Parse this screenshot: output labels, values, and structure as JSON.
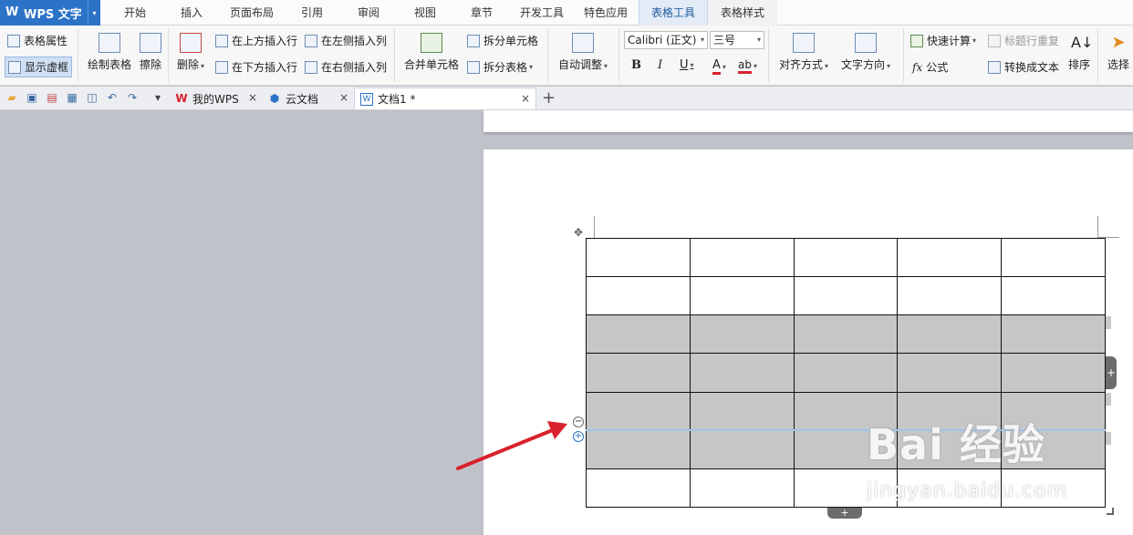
{
  "app": {
    "title": "WPS 文字",
    "logo": "W",
    "menu_arrow": "▾"
  },
  "menu_tabs": [
    "开始",
    "插入",
    "页面布局",
    "引用",
    "审阅",
    "视图",
    "章节",
    "开发工具",
    "特色应用",
    "表格工具",
    "表格样式"
  ],
  "ribbon": {
    "table_props": "表格属性",
    "show_gridlines": "显示虚框",
    "draw_table": "绘制表格",
    "erase": "擦除",
    "delete": "删除",
    "insert_row_above": "在上方插入行",
    "insert_row_below": "在下方插入行",
    "insert_col_left": "在左侧插入列",
    "insert_col_right": "在右侧插入列",
    "merge_cells": "合并单元格",
    "split_cells": "拆分单元格",
    "split_table": "拆分表格",
    "auto_fit": "自动调整",
    "font_name": "Calibri (正文)",
    "font_size": "三号",
    "bold": "B",
    "italic": "I",
    "underline": "U",
    "font_color": "A",
    "highlight": "ab",
    "align": "对齐方式",
    "text_direction": "文字方向",
    "quick_calc": "快速计算",
    "repeat_header": "标题行重复",
    "formula": "公式",
    "formula_icon": "fx",
    "convert_to_text": "转换成文本",
    "sort": "排序",
    "select": "选择"
  },
  "doc_tabs": [
    {
      "label": "我的WPS",
      "icon": "W"
    },
    {
      "label": "云文档",
      "icon": "⬢"
    },
    {
      "label": "文档1 *",
      "icon": "W"
    }
  ],
  "icons": {
    "close": "×",
    "plus": "+",
    "dropdown": "▾",
    "minus_ctrl": "−",
    "plus_ctrl": "+",
    "move": "✥"
  },
  "table": {
    "rows": 7,
    "cols": 5,
    "selected_rows": [
      2,
      3,
      4,
      5
    ]
  },
  "watermark": {
    "main": "Bai 经验",
    "sub": "jingyan.baidu.com"
  },
  "colors": {
    "accent": "#2b73c7",
    "selected_cell": "#c6c6c6",
    "arrow": "#d9212c"
  }
}
